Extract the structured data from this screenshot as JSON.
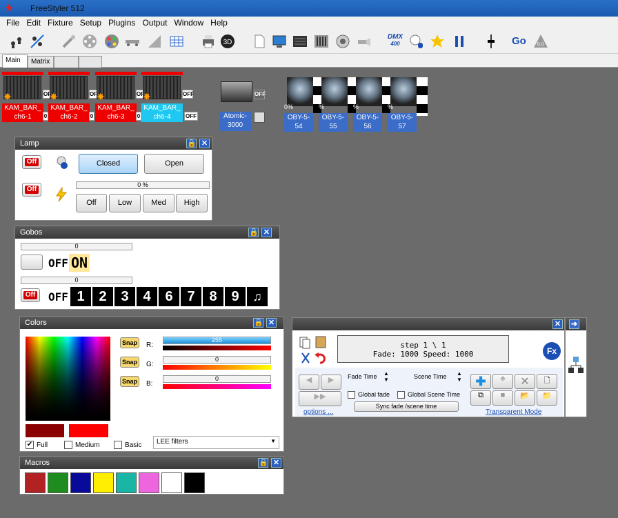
{
  "window": {
    "title": "FreeStyler 512"
  },
  "menu": [
    "File",
    "Edit",
    "Fixture",
    "Setup",
    "Plugins",
    "Output",
    "Window",
    "Help"
  ],
  "toolbar": {
    "dmx_label": "DMX",
    "dmx_sub": "400",
    "go_label": "Go"
  },
  "tabs": [
    "Main",
    "Matrix",
    "",
    ""
  ],
  "fixtures": {
    "kam": [
      {
        "name": "KAM_BAR_",
        "ch": "ch6-1"
      },
      {
        "name": "KAM_BAR_",
        "ch": "ch6-2"
      },
      {
        "name": "KAM_BAR_",
        "ch": "ch6-3"
      },
      {
        "name": "KAM_BAR_",
        "ch": "ch6-4"
      }
    ],
    "atomic": {
      "name": "Atomic-",
      "num": "3000"
    },
    "oby": [
      {
        "name": "OBY-5-",
        "num": "54",
        "pct": "0%"
      },
      {
        "name": "OBY-5-",
        "num": "55",
        "pct": "%"
      },
      {
        "name": "OBY-5-",
        "num": "56",
        "pct": "%"
      },
      {
        "name": "OBY-5-",
        "num": "57",
        "pct": "%"
      }
    ],
    "off_label": "OFF",
    "small_value": "0"
  },
  "lamp": {
    "title": "Lamp",
    "off": "Off",
    "closed": "Closed",
    "open": "Open",
    "progress": "0 %",
    "btn_off": "Off",
    "btn_low": "Low",
    "btn_med": "Med",
    "btn_high": "High"
  },
  "gobos": {
    "title": "Gobos",
    "bar1": "0",
    "bar2": "0",
    "off": "OFF",
    "on": "ON",
    "off_btn": "Off",
    "off2": "OFF",
    "numbers": [
      "1",
      "2",
      "3",
      "4",
      "6",
      "7",
      "8",
      "9"
    ]
  },
  "colors": {
    "title": "Colors",
    "snap": "Snap",
    "r_label": "R:",
    "g_label": "G:",
    "b_label": "B:",
    "r_value": "255",
    "g_value": "0",
    "b_value": "0",
    "full": "Full",
    "medium": "Medium",
    "basic": "Basic",
    "filter": "LEE filters",
    "r_color": "#ff0000",
    "dark_color": "#8b0000"
  },
  "macros": {
    "title": "Macros",
    "swatches": [
      "#b22222",
      "#1e8c1e",
      "#0a0a9a",
      "#ffee00",
      "#19b5a5",
      "#ee66dd",
      "#ffffff",
      "#000000"
    ]
  },
  "cue": {
    "step": "step 1 \\ 1",
    "fade": "Fade: 1000",
    "speed": "Speed: 1000",
    "fade_time": "Fade Time",
    "scene_time": "Scene Time",
    "global_fade": "Global fade",
    "global_scene": "Global Scene Time",
    "sync": "Sync fade /scene time",
    "options": "options ...",
    "transparent": "Transparent Mode",
    "fx": "Fx"
  }
}
